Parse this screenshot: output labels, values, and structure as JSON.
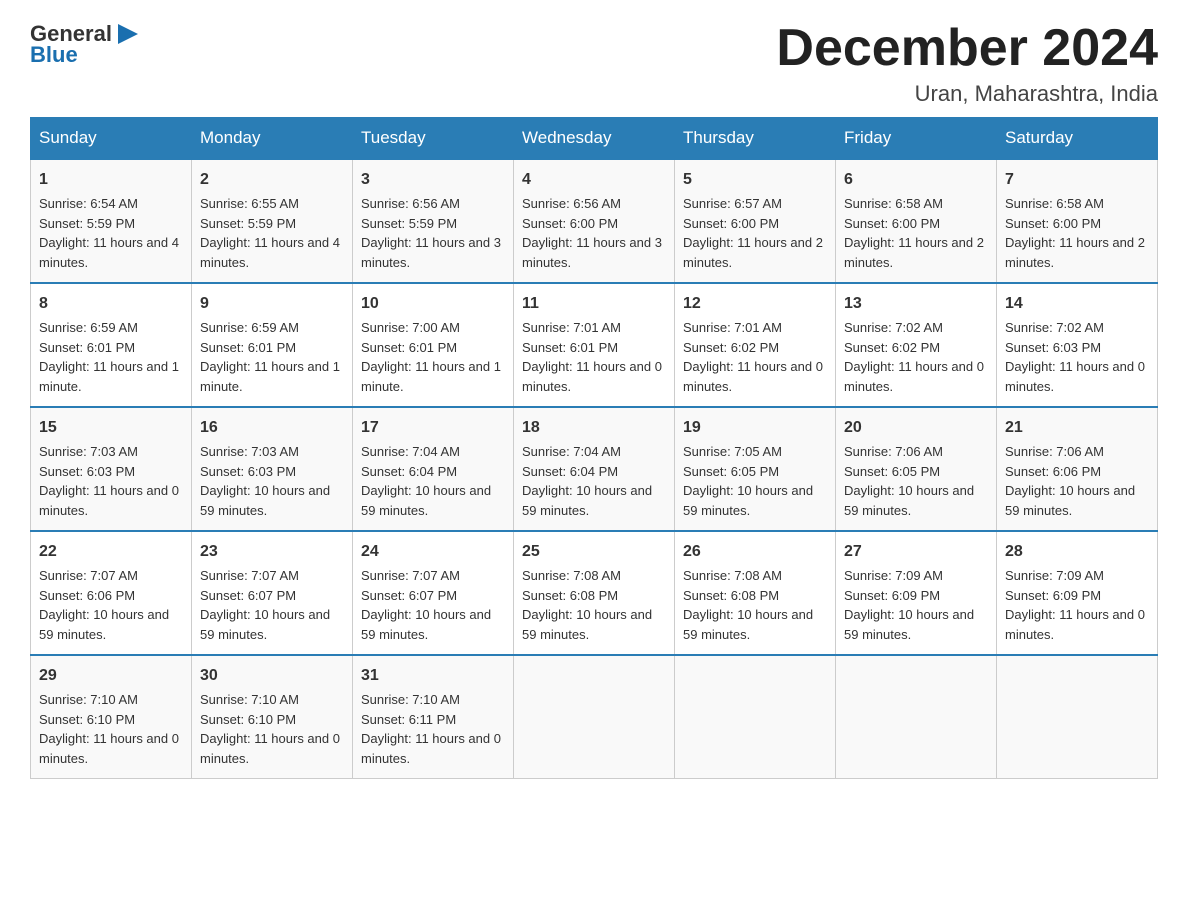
{
  "header": {
    "logo_general": "General",
    "logo_blue": "Blue",
    "month_title": "December 2024",
    "location": "Uran, Maharashtra, India"
  },
  "days_of_week": [
    "Sunday",
    "Monday",
    "Tuesday",
    "Wednesday",
    "Thursday",
    "Friday",
    "Saturday"
  ],
  "weeks": [
    [
      {
        "day": "1",
        "sunrise": "6:54 AM",
        "sunset": "5:59 PM",
        "daylight": "11 hours and 4 minutes."
      },
      {
        "day": "2",
        "sunrise": "6:55 AM",
        "sunset": "5:59 PM",
        "daylight": "11 hours and 4 minutes."
      },
      {
        "day": "3",
        "sunrise": "6:56 AM",
        "sunset": "5:59 PM",
        "daylight": "11 hours and 3 minutes."
      },
      {
        "day": "4",
        "sunrise": "6:56 AM",
        "sunset": "6:00 PM",
        "daylight": "11 hours and 3 minutes."
      },
      {
        "day": "5",
        "sunrise": "6:57 AM",
        "sunset": "6:00 PM",
        "daylight": "11 hours and 2 minutes."
      },
      {
        "day": "6",
        "sunrise": "6:58 AM",
        "sunset": "6:00 PM",
        "daylight": "11 hours and 2 minutes."
      },
      {
        "day": "7",
        "sunrise": "6:58 AM",
        "sunset": "6:00 PM",
        "daylight": "11 hours and 2 minutes."
      }
    ],
    [
      {
        "day": "8",
        "sunrise": "6:59 AM",
        "sunset": "6:01 PM",
        "daylight": "11 hours and 1 minute."
      },
      {
        "day": "9",
        "sunrise": "6:59 AM",
        "sunset": "6:01 PM",
        "daylight": "11 hours and 1 minute."
      },
      {
        "day": "10",
        "sunrise": "7:00 AM",
        "sunset": "6:01 PM",
        "daylight": "11 hours and 1 minute."
      },
      {
        "day": "11",
        "sunrise": "7:01 AM",
        "sunset": "6:01 PM",
        "daylight": "11 hours and 0 minutes."
      },
      {
        "day": "12",
        "sunrise": "7:01 AM",
        "sunset": "6:02 PM",
        "daylight": "11 hours and 0 minutes."
      },
      {
        "day": "13",
        "sunrise": "7:02 AM",
        "sunset": "6:02 PM",
        "daylight": "11 hours and 0 minutes."
      },
      {
        "day": "14",
        "sunrise": "7:02 AM",
        "sunset": "6:03 PM",
        "daylight": "11 hours and 0 minutes."
      }
    ],
    [
      {
        "day": "15",
        "sunrise": "7:03 AM",
        "sunset": "6:03 PM",
        "daylight": "11 hours and 0 minutes."
      },
      {
        "day": "16",
        "sunrise": "7:03 AM",
        "sunset": "6:03 PM",
        "daylight": "10 hours and 59 minutes."
      },
      {
        "day": "17",
        "sunrise": "7:04 AM",
        "sunset": "6:04 PM",
        "daylight": "10 hours and 59 minutes."
      },
      {
        "day": "18",
        "sunrise": "7:04 AM",
        "sunset": "6:04 PM",
        "daylight": "10 hours and 59 minutes."
      },
      {
        "day": "19",
        "sunrise": "7:05 AM",
        "sunset": "6:05 PM",
        "daylight": "10 hours and 59 minutes."
      },
      {
        "day": "20",
        "sunrise": "7:06 AM",
        "sunset": "6:05 PM",
        "daylight": "10 hours and 59 minutes."
      },
      {
        "day": "21",
        "sunrise": "7:06 AM",
        "sunset": "6:06 PM",
        "daylight": "10 hours and 59 minutes."
      }
    ],
    [
      {
        "day": "22",
        "sunrise": "7:07 AM",
        "sunset": "6:06 PM",
        "daylight": "10 hours and 59 minutes."
      },
      {
        "day": "23",
        "sunrise": "7:07 AM",
        "sunset": "6:07 PM",
        "daylight": "10 hours and 59 minutes."
      },
      {
        "day": "24",
        "sunrise": "7:07 AM",
        "sunset": "6:07 PM",
        "daylight": "10 hours and 59 minutes."
      },
      {
        "day": "25",
        "sunrise": "7:08 AM",
        "sunset": "6:08 PM",
        "daylight": "10 hours and 59 minutes."
      },
      {
        "day": "26",
        "sunrise": "7:08 AM",
        "sunset": "6:08 PM",
        "daylight": "10 hours and 59 minutes."
      },
      {
        "day": "27",
        "sunrise": "7:09 AM",
        "sunset": "6:09 PM",
        "daylight": "10 hours and 59 minutes."
      },
      {
        "day": "28",
        "sunrise": "7:09 AM",
        "sunset": "6:09 PM",
        "daylight": "11 hours and 0 minutes."
      }
    ],
    [
      {
        "day": "29",
        "sunrise": "7:10 AM",
        "sunset": "6:10 PM",
        "daylight": "11 hours and 0 minutes."
      },
      {
        "day": "30",
        "sunrise": "7:10 AM",
        "sunset": "6:10 PM",
        "daylight": "11 hours and 0 minutes."
      },
      {
        "day": "31",
        "sunrise": "7:10 AM",
        "sunset": "6:11 PM",
        "daylight": "11 hours and 0 minutes."
      },
      null,
      null,
      null,
      null
    ]
  ],
  "labels": {
    "sunrise": "Sunrise:",
    "sunset": "Sunset:",
    "daylight": "Daylight:"
  }
}
